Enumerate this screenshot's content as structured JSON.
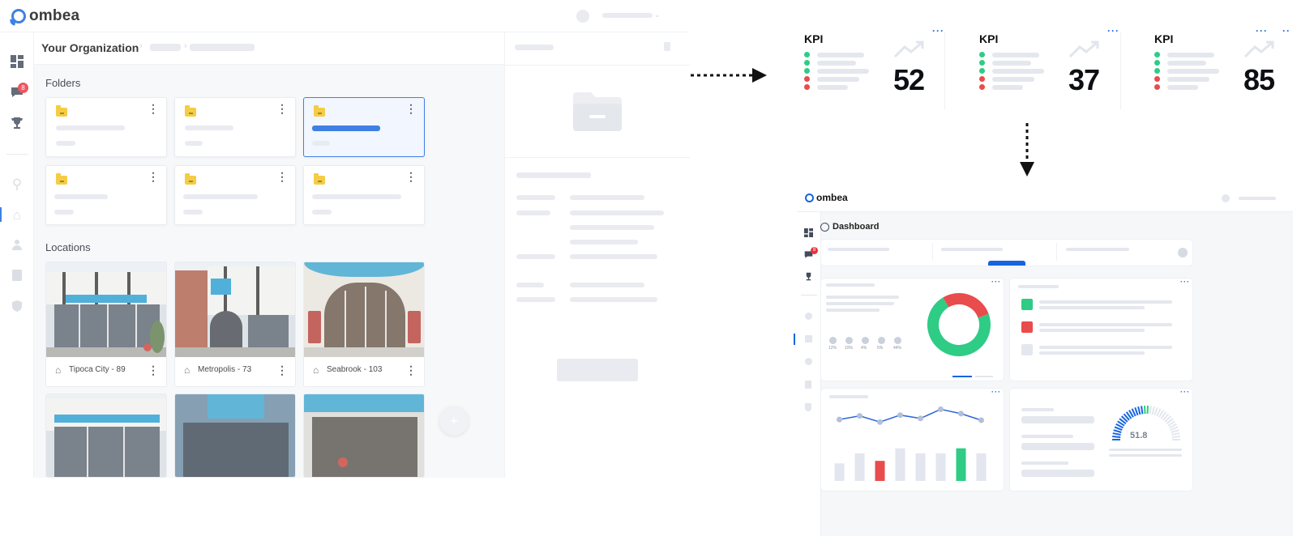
{
  "app": {
    "brand": "ombea",
    "badge_count": "8",
    "org_title": "Your Organization",
    "sections": {
      "folders": "Folders",
      "locations": "Locations"
    },
    "locations": [
      {
        "name": "Tipoca City - 89"
      },
      {
        "name": "Metropolis - 73"
      },
      {
        "name": "Seabrook - 103"
      }
    ],
    "add_symbol": "+"
  },
  "kpis": [
    {
      "title": "KPI",
      "value": "52",
      "more": "···"
    },
    {
      "title": "KPI",
      "value": "37",
      "more": "···"
    },
    {
      "title": "KPI",
      "value": "85",
      "more": "···"
    }
  ],
  "dashboard": {
    "brand": "ombea",
    "title": "Dashboard",
    "badge_count": "8",
    "legend_pcts": [
      "12%",
      "10%",
      "4%",
      "5%",
      "44%"
    ],
    "gauge_value": "51.8",
    "donut": {
      "green_fraction": 0.72,
      "red_fraction": 0.28
    },
    "line_values": [
      0.62,
      0.72,
      0.55,
      0.74,
      0.65,
      0.9,
      0.78,
      0.6
    ],
    "bar_values": [
      0.35,
      0.55,
      0.4,
      0.65,
      0.55,
      0.55,
      0.65,
      0.55
    ],
    "bar_colors": [
      "#e3e6ef",
      "#e3e6ef",
      "#e84c4c",
      "#e3e6ef",
      "#e3e6ef",
      "#e3e6ef",
      "#2ecc85",
      "#e3e6ef"
    ]
  },
  "colors": {
    "accent": "#1565e0",
    "green": "#2ecc85",
    "red": "#e84c4c",
    "folder": "#f3c21b"
  },
  "icons": [
    "dashboard-icon",
    "chat-icon",
    "trophy-icon",
    "location-pin-icon",
    "building-icon",
    "user-icon",
    "book-icon",
    "shield-icon",
    "folder-icon",
    "home-icon",
    "kebab-menu-icon",
    "trending-up-icon",
    "arrow-right-icon",
    "arrow-down-icon",
    "plus-icon",
    "trash-icon"
  ]
}
